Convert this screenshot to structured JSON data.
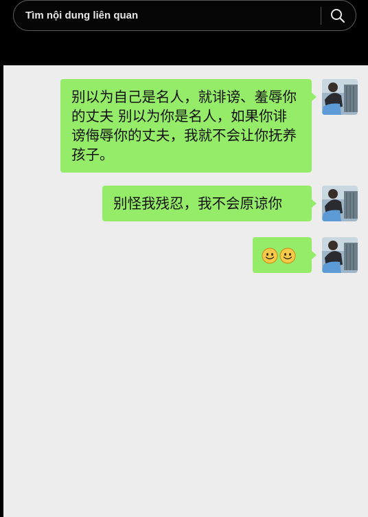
{
  "search": {
    "value": "Tìm nội dung liên quan"
  },
  "messages": [
    {
      "sender": "me",
      "text": "别以为自己是名人，就诽谤、羞辱你的丈夫 别以为你是名人，如果你诽谤侮辱你的丈夫，我就不会让你抚养孩子。"
    },
    {
      "sender": "me",
      "text": "别怪我残忍，我不会原谅你"
    },
    {
      "sender": "me",
      "emoji": [
        "smile-emoji",
        "smile-emoji"
      ]
    }
  ],
  "icons": {
    "search": "search-icon",
    "emoji": "smile-emoji"
  },
  "colors": {
    "bubble": "#95ec69",
    "chat_background": "#ededed",
    "top_bar": "#000000"
  }
}
